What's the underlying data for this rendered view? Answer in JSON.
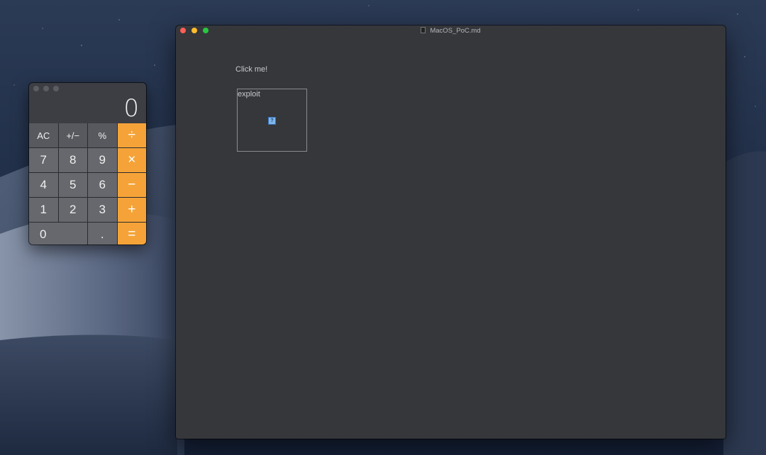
{
  "colors": {
    "operator_key": "#f5a338",
    "close_light": "#fd5f57",
    "minimize_light": "#febc2e",
    "zoom_light": "#28c840",
    "window_bg": "#36373b"
  },
  "calculator": {
    "display_value": "0",
    "keys": {
      "ac": "AC",
      "plus_minus": "+/−",
      "percent": "%",
      "divide": "÷",
      "seven": "7",
      "eight": "8",
      "nine": "9",
      "multiply": "×",
      "four": "4",
      "five": "5",
      "six": "6",
      "minus": "−",
      "one": "1",
      "two": "2",
      "three": "3",
      "plus": "+",
      "zero": "0",
      "decimal": ".",
      "equals": "="
    }
  },
  "window": {
    "title": "MacOS_PoC.md",
    "content": {
      "link_text": "Click me!",
      "frame_label": "exploit",
      "missing_image_icon": "question-mark-icon"
    }
  }
}
